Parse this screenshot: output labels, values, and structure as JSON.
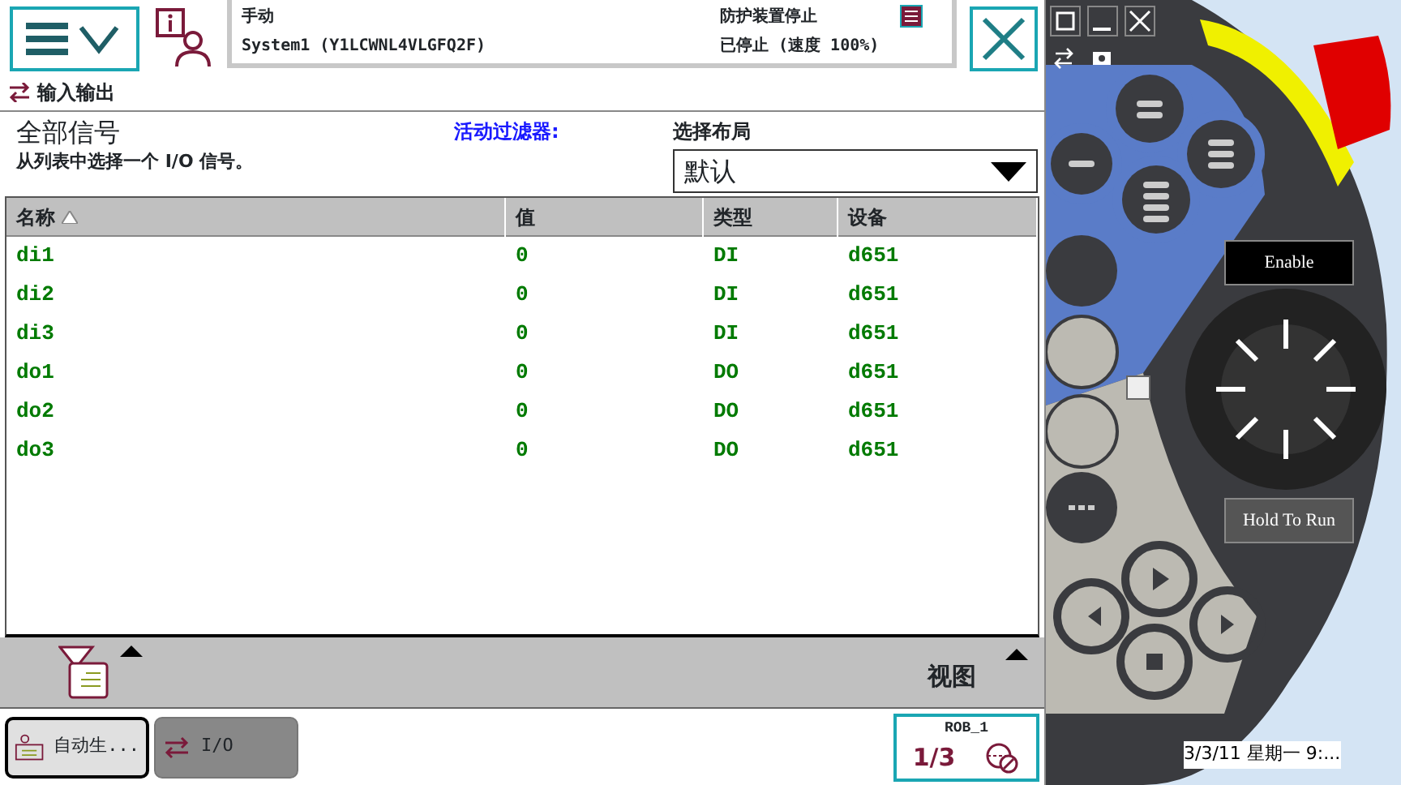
{
  "status": {
    "mode": "手动",
    "system": "System1 (Y1LCWNL4VLGFQ2F)",
    "guard": "防护装置停止",
    "state": "已停止 (速度 100%)"
  },
  "breadcrumb": "输入输出",
  "panel": {
    "title": "全部信号",
    "subtitle": "从列表中选择一个 I/O 信号。",
    "filter_label": "活动过滤器:",
    "layout_label": "选择布局",
    "layout_value": "默认"
  },
  "table": {
    "columns": [
      {
        "label": "名称",
        "sorted": true
      },
      {
        "label": "值",
        "sorted": false
      },
      {
        "label": "类型",
        "sorted": false
      },
      {
        "label": "设备",
        "sorted": false
      }
    ],
    "rows": [
      [
        "di1",
        "0",
        "DI",
        "d651"
      ],
      [
        "di2",
        "0",
        "DI",
        "d651"
      ],
      [
        "di3",
        "0",
        "DI",
        "d651"
      ],
      [
        "do1",
        "0",
        "DO",
        "d651"
      ],
      [
        "do2",
        "0",
        "DO",
        "d651"
      ],
      [
        "do3",
        "0",
        "DO",
        "d651"
      ]
    ]
  },
  "command_bar": {
    "view": "视图"
  },
  "taskbar": {
    "tasks": [
      {
        "label": "自动生...",
        "kind": "program",
        "selected": true
      },
      {
        "label": "I/O",
        "kind": "io",
        "selected": false
      }
    ],
    "robot": "ROB_1",
    "fraction": "1/3"
  },
  "pendant": {
    "enable": "Enable",
    "hold_to_run": "Hold To Run"
  },
  "desktop_text": "3/3/11 星期一 9:..."
}
